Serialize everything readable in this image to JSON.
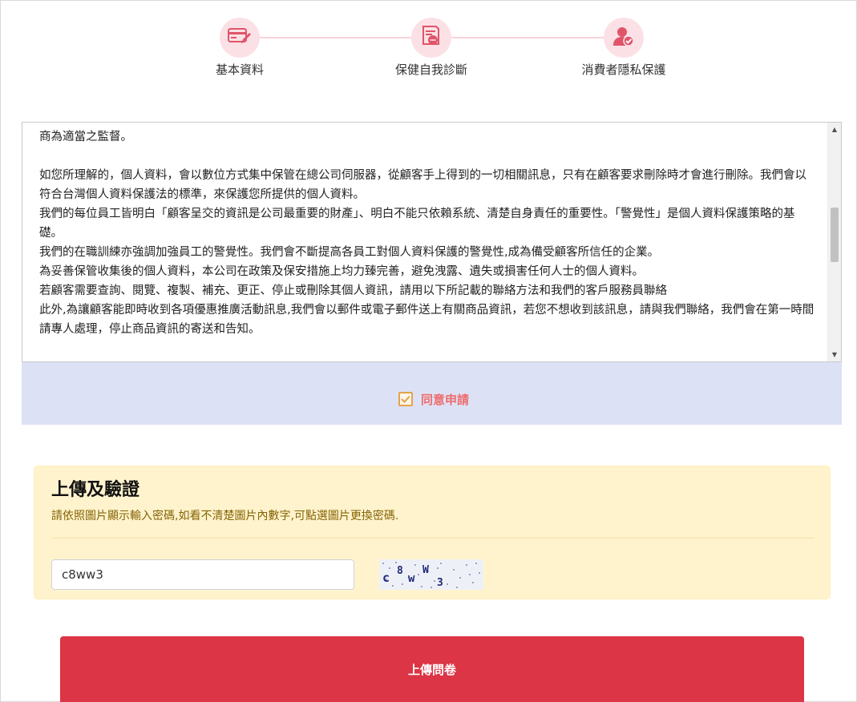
{
  "steps": [
    {
      "label": "基本資料",
      "icon": "credit-card-pen-icon"
    },
    {
      "label": "保健自我診斷",
      "icon": "document-chat-icon"
    },
    {
      "label": "消費者隱私保護",
      "icon": "user-check-icon"
    }
  ],
  "terms": {
    "paragraphs": [
      "商為適當之監督。",
      "",
      "如您所理解的，個人資料，會以數位方式集中保管在總公司伺服器，從顧客手上得到的一切相關訊息，只有在顧客要求刪除時才會進行刪除。我們會以符合台灣個人資料保護法的標準，來保護您所提供的個人資料。",
      "我們的每位員工皆明白「顧客呈交的資訊是公司最重要的財產」、明白不能只依賴系統、清楚自身責任的重要性。「警覺性」是個人資料保護策略的基礎。",
      "我們的在職訓練亦強調加強員工的警覺性。我們會不斷提高各員工對個人資料保護的警覺性,成為備受顧客所信任的企業。",
      "為妥善保管收集後的個人資料，本公司在政策及保安措施上均力臻完善，避免洩露、遺失或損害任何人士的個人資料。",
      "若顧客需要查詢、閱覽、複製、補充、更正、停止或刪除其個人資訊，請用以下所記載的聯絡方法和我們的客戶服務員聯絡",
      "此外,為讓顧客能即時收到各項優惠推廣活動訊息,我們會以郵件或電子郵件送上有關商品資訊，若您不想收到該訊息，請與我們聯絡，我們會在第一時間請專人處理，停止商品資訊的寄送和告知。"
    ]
  },
  "agree": {
    "label": "同意申請",
    "checked": true
  },
  "verify": {
    "title": "上傳及驗證",
    "hint": "請依照圖片顯示輸入密碼,如看不清楚圖片內數字,可點選圖片更換密碼.",
    "input_value": "c8ww3",
    "captcha_chars": [
      "c",
      "8",
      "w",
      "W",
      "3"
    ]
  },
  "submit": {
    "label": "上傳問卷"
  },
  "colors": {
    "accent": "#dc3545",
    "step_bg": "#fbe1e6",
    "step_icon": "#e0546a",
    "agree_bar": "#dde1f6",
    "verify_bg": "#fff3cd"
  }
}
